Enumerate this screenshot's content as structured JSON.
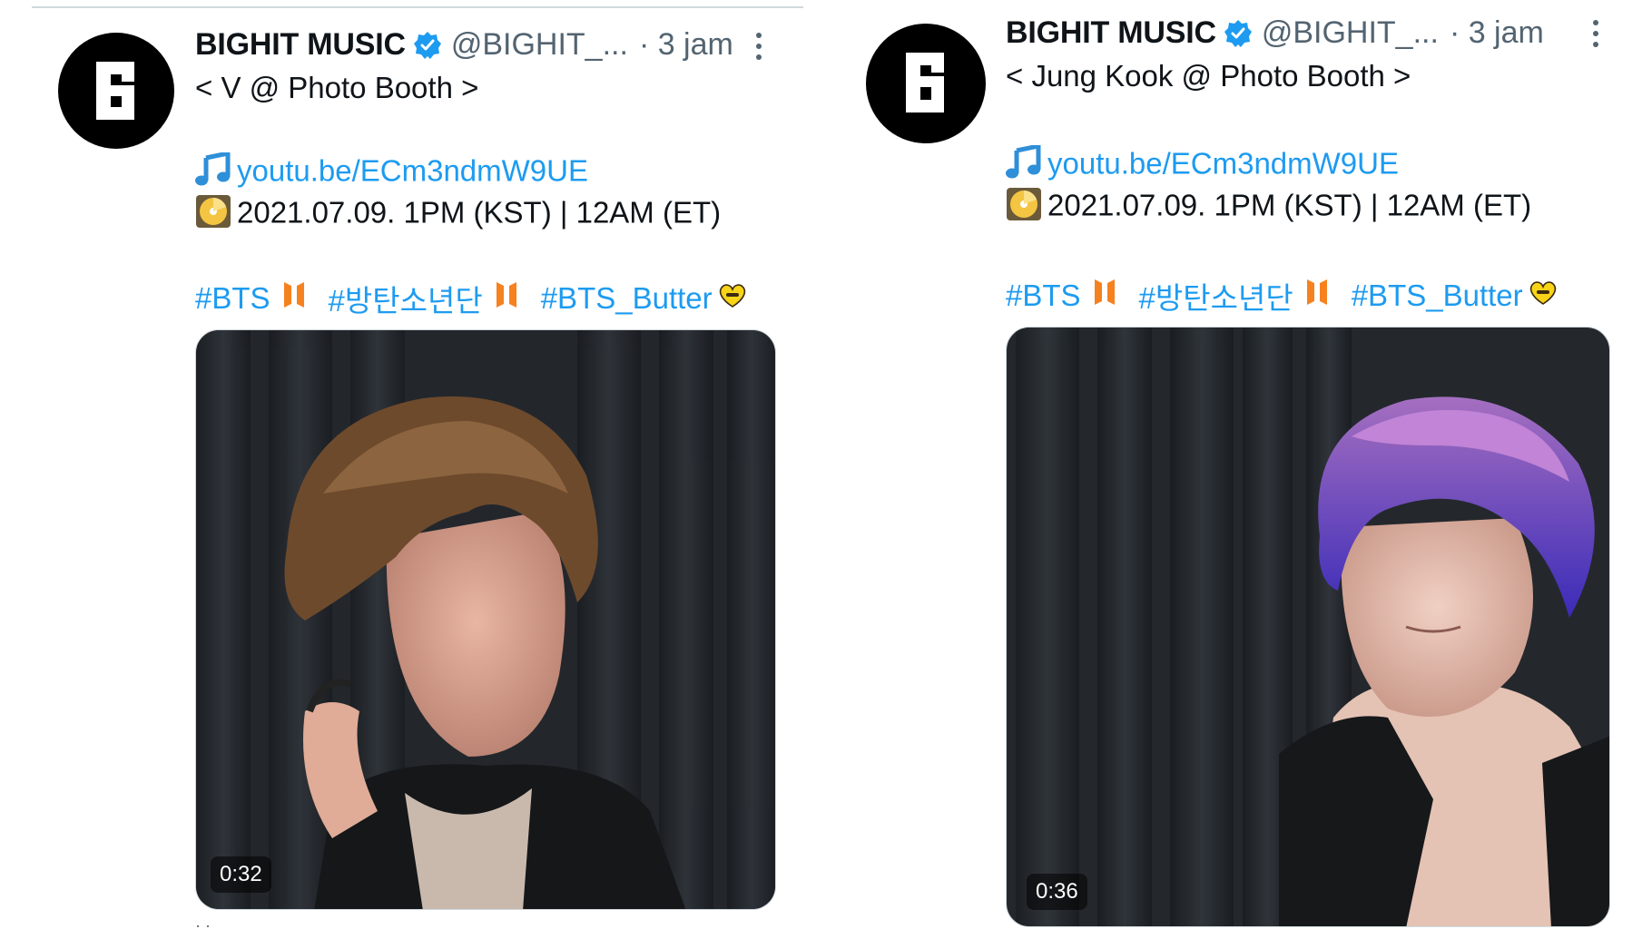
{
  "tweets": [
    {
      "display_name": "BIGHIT MUSIC",
      "handle": "@BIGHIT_...",
      "time": "· 3 jam",
      "title_line": "< V @ Photo Booth >",
      "link": "youtu.be/ECm3ndmW9UE",
      "date_line": "2021.07.09. 1PM (KST) | 12AM (ET)",
      "hashtags": [
        "#BTS",
        "#방탄소년단",
        "#BTS_Butter"
      ],
      "video_duration": "0:32",
      "icons": [
        "verified-badge-icon",
        "more-options-icon",
        "music-note-emoji",
        "dvd-disc-emoji",
        "bts-logo-emoji",
        "butter-heart-emoji"
      ]
    },
    {
      "display_name": "BIGHIT MUSIC",
      "handle": "@BIGHIT_...",
      "time": "· 3 jam",
      "title_line": "< Jung Kook @ Photo Booth >",
      "link": "youtu.be/ECm3ndmW9UE",
      "date_line": "2021.07.09. 1PM (KST) | 12AM (ET)",
      "hashtags": [
        "#BTS",
        "#방탄소년단",
        "#BTS_Butter"
      ],
      "video_duration": "0:36",
      "icons": [
        "verified-badge-icon",
        "more-options-icon",
        "music-note-emoji",
        "dvd-disc-emoji",
        "bts-logo-emoji",
        "butter-heart-emoji"
      ]
    }
  ],
  "colors": {
    "link": "#1d9bf0",
    "secondary_text": "#536471",
    "primary_text": "#0f1419",
    "hashtag_emoji_orange": "#f5821f",
    "butter_yellow": "#f7d417"
  }
}
